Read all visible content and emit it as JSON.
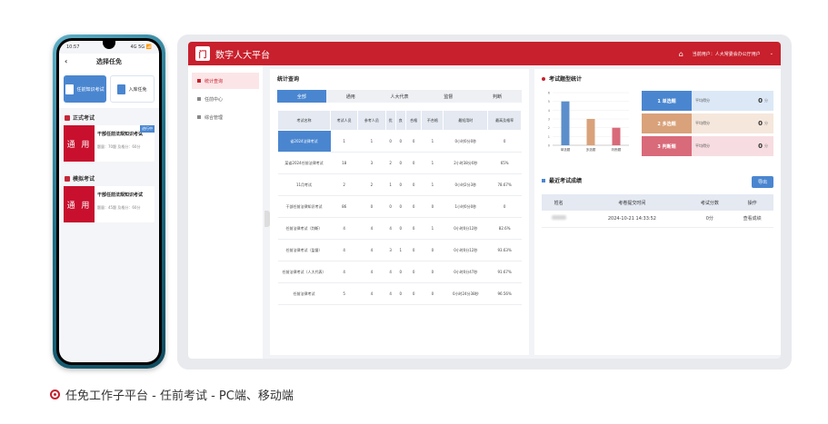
{
  "phone": {
    "time": "10:57",
    "signal": "4G 5G 📶",
    "title": "选择任免",
    "tabs": [
      {
        "label": "任前知识考试",
        "active": true
      },
      {
        "label": "入库任免",
        "active": false
      }
    ],
    "sections": [
      {
        "title": "正式考试",
        "cards": [
          {
            "thumb": "通 用",
            "title": "干部任前法规知识考试",
            "meta": "题量：70题  及格分：60分",
            "badge": "进行中"
          }
        ]
      },
      {
        "title": "模拟考试",
        "cards": [
          {
            "thumb": "通 用",
            "title": "干部任前法规知识考试",
            "meta": "题量：45题  及格分：60分",
            "badge": ""
          }
        ]
      }
    ]
  },
  "tablet": {
    "brand": "数字人大平台",
    "logo_char": "门",
    "user_info": "当前用户：人大常委会办公厅用户",
    "sidebar": [
      {
        "label": "统计查询",
        "active": true
      },
      {
        "label": "任前中心",
        "active": false
      },
      {
        "label": "综合管理",
        "active": false
      }
    ],
    "stats": {
      "title": "统计查询",
      "tabs": [
        "全部",
        "通用",
        "人大代表",
        "监督",
        "判断"
      ],
      "headers": [
        "考试名称",
        "考试人员",
        "参考人员",
        "优",
        "良",
        "合格",
        "不合格",
        "最短用时",
        "最高及格率"
      ],
      "rows": [
        [
          "省2024法律考试",
          "1",
          "1",
          "0",
          "0",
          "0",
          "1",
          "0小时0分0秒",
          "0"
        ],
        [
          "某省2024任前法律考试",
          "18",
          "3",
          "2",
          "0",
          "0",
          "1",
          "2小时38分0秒",
          "65%"
        ],
        [
          "11月考试",
          "2",
          "2",
          "1",
          "0",
          "0",
          "1",
          "0小时2分3秒",
          "78.67%"
        ],
        [
          "干部任前法律知识考试",
          "86",
          "0",
          "0",
          "0",
          "0",
          "0",
          "1小时0分0秒",
          "0"
        ],
        [
          "任前法律考试（判断）",
          "4",
          "4",
          "4",
          "0",
          "0",
          "1",
          "0小时0分12秒",
          "82.6%"
        ],
        [
          "任前法律考试（监督）",
          "4",
          "4",
          "3",
          "1",
          "0",
          "0",
          "0小时0分12秒",
          "93.63%"
        ],
        [
          "任前法律考试（人大代表）",
          "4",
          "4",
          "4",
          "0",
          "0",
          "0",
          "0小时0分47秒",
          "91.67%"
        ],
        [
          "任前法律考试",
          "5",
          "4",
          "4",
          "0",
          "0",
          "0",
          "0小时24分38秒",
          "96.56%"
        ]
      ]
    },
    "score_stats": {
      "title": "考试题型统计",
      "cards": [
        {
          "label": "1 单选题",
          "sub": "平均得分",
          "value": "0",
          "unit": "分",
          "color": "#4a86d0",
          "bg": "#dce8f6"
        },
        {
          "label": "2 多选题",
          "sub": "平均得分",
          "value": "0",
          "unit": "分",
          "color": "#d9a27a",
          "bg": "#f5e7dc"
        },
        {
          "label": "3 判断题",
          "sub": "平均得分",
          "value": "0",
          "unit": "分",
          "color": "#d96a7a",
          "bg": "#f7dde1"
        }
      ]
    },
    "recent": {
      "title": "最近考试成绩",
      "export_label": "导出",
      "headers": [
        "姓名",
        "考卷提交时间",
        "考试分数",
        "操作"
      ],
      "rows": [
        {
          "time": "2024-10-21 14:33:52",
          "score": "0分",
          "action": "查看成绩"
        }
      ]
    }
  },
  "chart_data": {
    "type": "bar",
    "categories": [
      "单选题",
      "多选题",
      "判断题"
    ],
    "values": [
      5,
      3,
      2
    ],
    "colors": [
      "#5b8ecb",
      "#d9a27a",
      "#d96a7a"
    ],
    "ylim": [
      0,
      6
    ],
    "yticks": [
      0,
      1,
      2,
      3,
      4,
      5,
      6
    ]
  },
  "caption": "任免工作子平台 - 任前考试 - PC端、移动端"
}
